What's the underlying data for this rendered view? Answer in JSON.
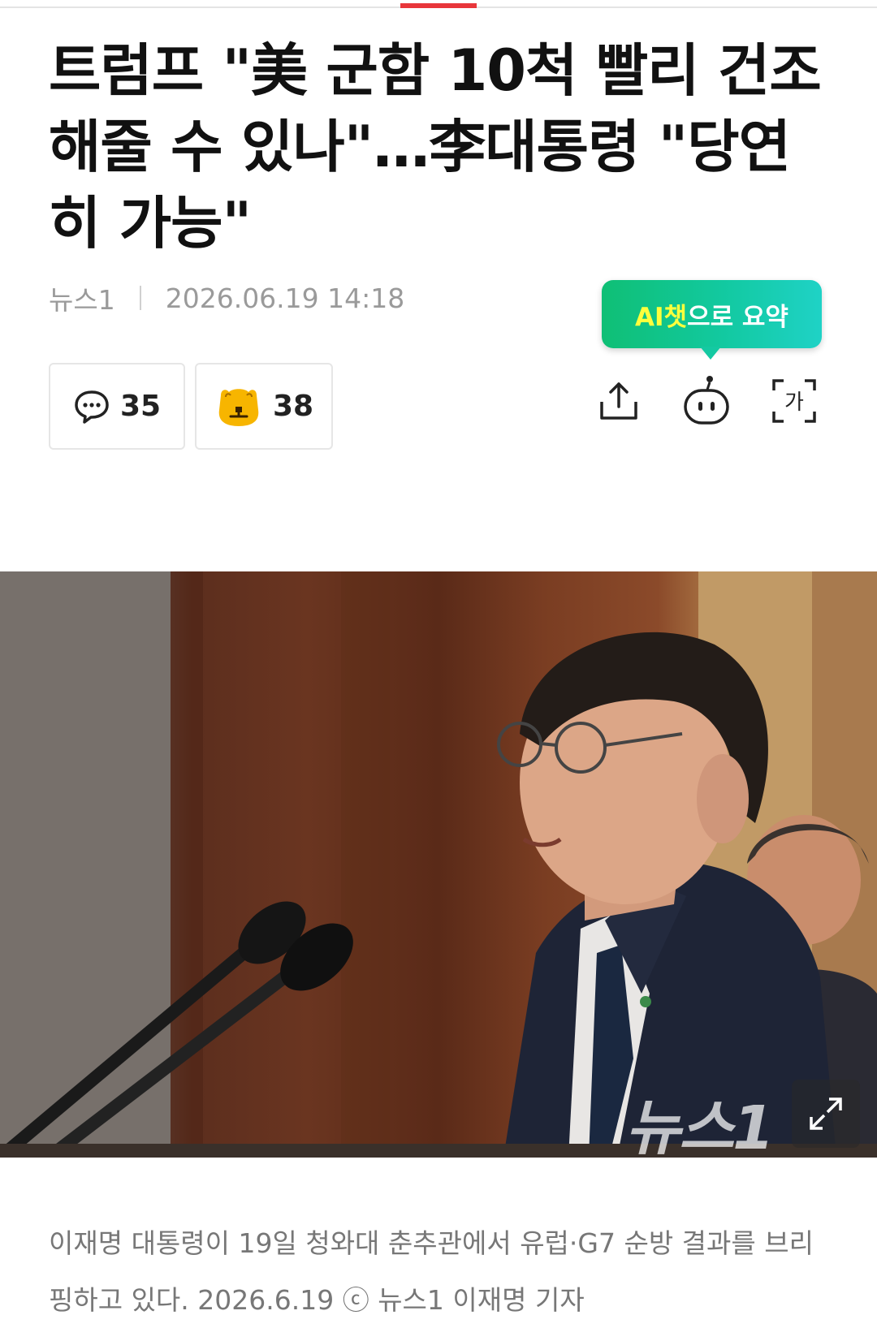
{
  "article": {
    "headline": "트럼프 \"美 군함 10척 빨리 건조 해줄 수 있나\"…李대통령 \"당연히 가능\"",
    "source": "뉴스1",
    "datetime": "2026.06.19 14:18"
  },
  "ai_summary": {
    "label_highlight": "AI챗",
    "label_rest": "으로 요약"
  },
  "stats": {
    "comments": "35",
    "reactions": "38"
  },
  "toolbar": {
    "share_icon": "share-icon",
    "bot_icon": "ai-chatbot-icon",
    "font_icon_text": "가"
  },
  "photo": {
    "watermark": "뉴스1",
    "caption": "이재명 대통령이 19일 청와대 춘추관에서 유럽·G7 순방 결과를 브리핑하고 있다. 2026.6.19 ⓒ 뉴스1 이재명 기자"
  },
  "colors": {
    "accent": "#e8363b",
    "ai_green": "#12c9a0",
    "ai_highlight": "#ffff3c"
  }
}
